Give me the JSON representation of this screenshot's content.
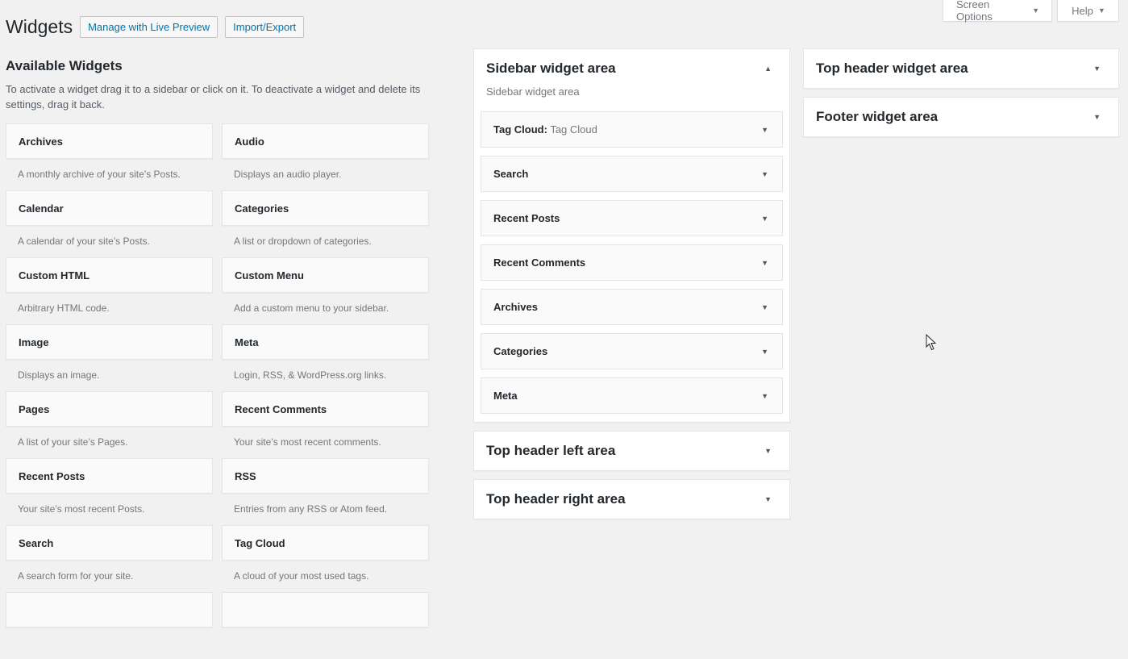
{
  "screen_options": {
    "label": "Screen Options"
  },
  "help": {
    "label": "Help"
  },
  "header": {
    "title": "Widgets",
    "live_preview": "Manage with Live Preview",
    "import_export": "Import/Export"
  },
  "available": {
    "title": "Available Widgets",
    "description": "To activate a widget drag it to a sidebar or click on it. To deactivate a widget and delete its settings, drag it back.",
    "widgets": [
      {
        "name": "Archives",
        "desc": "A monthly archive of your site’s Posts."
      },
      {
        "name": "Audio",
        "desc": "Displays an audio player."
      },
      {
        "name": "Calendar",
        "desc": "A calendar of your site’s Posts."
      },
      {
        "name": "Categories",
        "desc": "A list or dropdown of categories."
      },
      {
        "name": "Custom HTML",
        "desc": "Arbitrary HTML code."
      },
      {
        "name": "Custom Menu",
        "desc": "Add a custom menu to your sidebar."
      },
      {
        "name": "Image",
        "desc": "Displays an image."
      },
      {
        "name": "Meta",
        "desc": "Login, RSS, & WordPress.org links."
      },
      {
        "name": "Pages",
        "desc": "A list of your site’s Pages."
      },
      {
        "name": "Recent Comments",
        "desc": "Your site’s most recent comments."
      },
      {
        "name": "Recent Posts",
        "desc": "Your site’s most recent Posts."
      },
      {
        "name": "RSS",
        "desc": "Entries from any RSS or Atom feed."
      },
      {
        "name": "Search",
        "desc": "A search form for your site."
      },
      {
        "name": "Tag Cloud",
        "desc": "A cloud of your most used tags."
      }
    ]
  },
  "sidebar_area": {
    "title": "Sidebar widget area",
    "description": "Sidebar widget area",
    "widgets": [
      {
        "name": "Tag Cloud",
        "sub": ": Tag Cloud"
      },
      {
        "name": "Search",
        "sub": ""
      },
      {
        "name": "Recent Posts",
        "sub": ""
      },
      {
        "name": "Recent Comments",
        "sub": ""
      },
      {
        "name": "Archives",
        "sub": ""
      },
      {
        "name": "Categories",
        "sub": ""
      },
      {
        "name": "Meta",
        "sub": ""
      }
    ]
  },
  "areas": {
    "top_header_left": "Top header left area",
    "top_header_right": "Top header right area",
    "top_header_widget": "Top header widget area",
    "footer_widget": "Footer widget area"
  },
  "icons": {
    "caret_down": "caret-down-icon",
    "caret_up": "caret-up-icon",
    "cursor": "mouse-pointer-icon"
  }
}
